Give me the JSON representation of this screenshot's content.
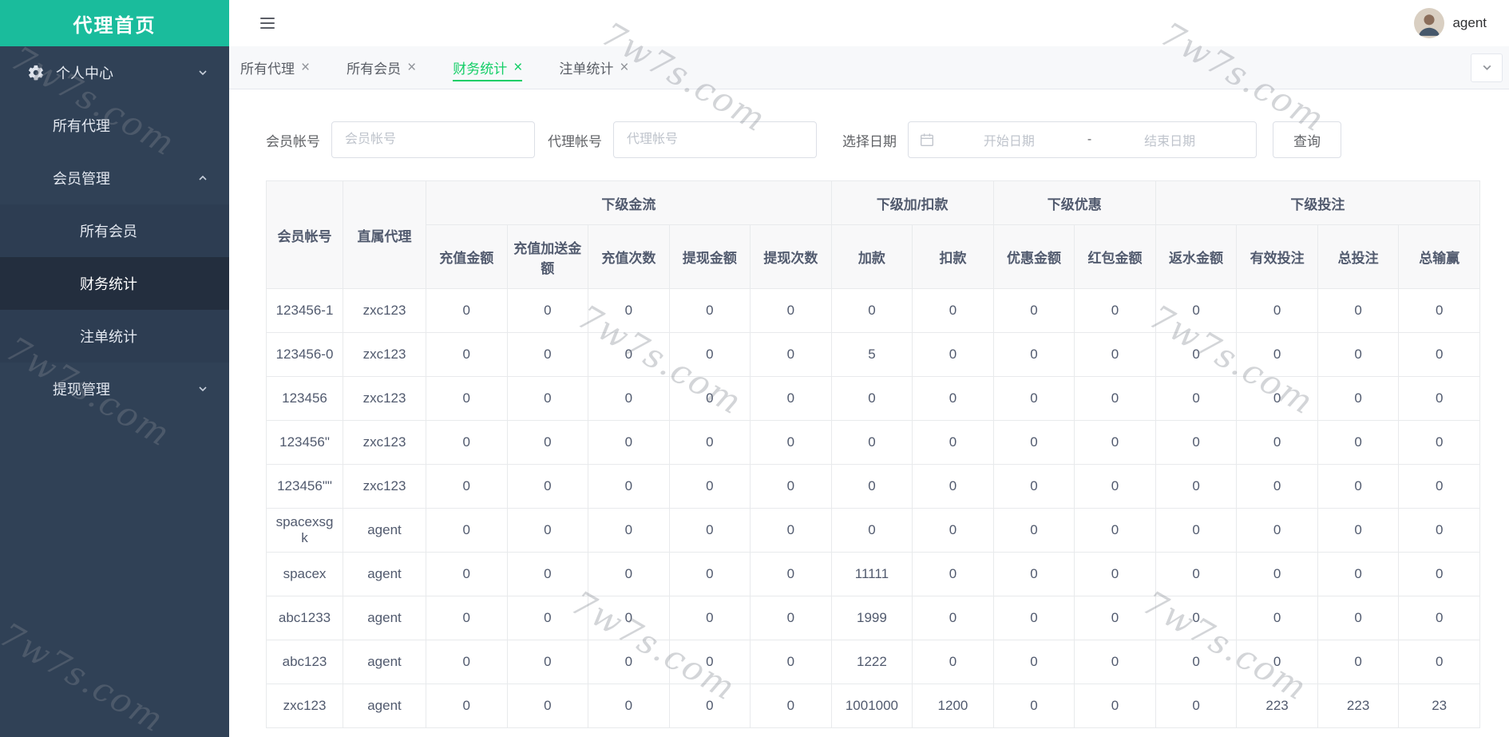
{
  "app": {
    "title": "代理首页",
    "user": "agent"
  },
  "colors": {
    "logo_teal": "#1abc9c",
    "sidebar_dark": "#304156",
    "accent_green": "#13ce66"
  },
  "sidebar": {
    "items": [
      {
        "label": "个人中心",
        "level": 1,
        "icon": "gear-icon",
        "chevron": "down"
      },
      {
        "label": "所有代理",
        "level": 2
      },
      {
        "label": "会员管理",
        "level": 2,
        "chevron": "up"
      },
      {
        "label": "所有会员",
        "level": 3
      },
      {
        "label": "财务统计",
        "level": 3,
        "active": true
      },
      {
        "label": "注单统计",
        "level": 3
      },
      {
        "label": "提现管理",
        "level": 2,
        "chevron": "down"
      }
    ]
  },
  "tabs": [
    {
      "label": "所有代理",
      "active": false
    },
    {
      "label": "所有会员",
      "active": false
    },
    {
      "label": "财务统计",
      "active": true
    },
    {
      "label": "注单统计",
      "active": false
    }
  ],
  "filters": {
    "member_label": "会员帐号",
    "member_placeholder": "会员帐号",
    "agent_label": "代理帐号",
    "agent_placeholder": "代理帐号",
    "date_label": "选择日期",
    "date_start_placeholder": "开始日期",
    "date_separator": "-",
    "date_end_placeholder": "结束日期",
    "search_button": "查询"
  },
  "table": {
    "fixed_headers": [
      "会员帐号",
      "直属代理"
    ],
    "groups": [
      {
        "label": "下级金流",
        "span": 5
      },
      {
        "label": "下级加/扣款",
        "span": 2
      },
      {
        "label": "下级优惠",
        "span": 2
      },
      {
        "label": "下级投注",
        "span": 4
      }
    ],
    "sub_headers": [
      "充值金额",
      "充值加送金额",
      "充值次数",
      "提现金额",
      "提现次数",
      "加款",
      "扣款",
      "优惠金额",
      "红包金额",
      "返水金额",
      "有效投注",
      "总投注",
      "总输赢"
    ],
    "rows": [
      [
        "123456-1",
        "zxc123",
        "0",
        "0",
        "0",
        "0",
        "0",
        "0",
        "0",
        "0",
        "0",
        "0",
        "0",
        "0",
        "0"
      ],
      [
        "123456-0",
        "zxc123",
        "0",
        "0",
        "0",
        "0",
        "0",
        "5",
        "0",
        "0",
        "0",
        "0",
        "0",
        "0",
        "0"
      ],
      [
        "123456",
        "zxc123",
        "0",
        "0",
        "0",
        "0",
        "0",
        "0",
        "0",
        "0",
        "0",
        "0",
        "0",
        "0",
        "0"
      ],
      [
        "123456\"",
        "zxc123",
        "0",
        "0",
        "0",
        "0",
        "0",
        "0",
        "0",
        "0",
        "0",
        "0",
        "0",
        "0",
        "0"
      ],
      [
        "123456\"\"",
        "zxc123",
        "0",
        "0",
        "0",
        "0",
        "0",
        "0",
        "0",
        "0",
        "0",
        "0",
        "0",
        "0",
        "0"
      ],
      [
        "spacexsgk",
        "agent",
        "0",
        "0",
        "0",
        "0",
        "0",
        "0",
        "0",
        "0",
        "0",
        "0",
        "0",
        "0",
        "0"
      ],
      [
        "spacex",
        "agent",
        "0",
        "0",
        "0",
        "0",
        "0",
        "11111",
        "0",
        "0",
        "0",
        "0",
        "0",
        "0",
        "0"
      ],
      [
        "abc1233",
        "agent",
        "0",
        "0",
        "0",
        "0",
        "0",
        "1999",
        "0",
        "0",
        "0",
        "0",
        "0",
        "0",
        "0"
      ],
      [
        "abc123",
        "agent",
        "0",
        "0",
        "0",
        "0",
        "0",
        "1222",
        "0",
        "0",
        "0",
        "0",
        "0",
        "0",
        "0"
      ],
      [
        "zxc123",
        "agent",
        "0",
        "0",
        "0",
        "0",
        "0",
        "1001000",
        "1200",
        "0",
        "0",
        "0",
        "223",
        "223",
        "23"
      ]
    ]
  },
  "watermark": {
    "text": "7w7s.com"
  }
}
